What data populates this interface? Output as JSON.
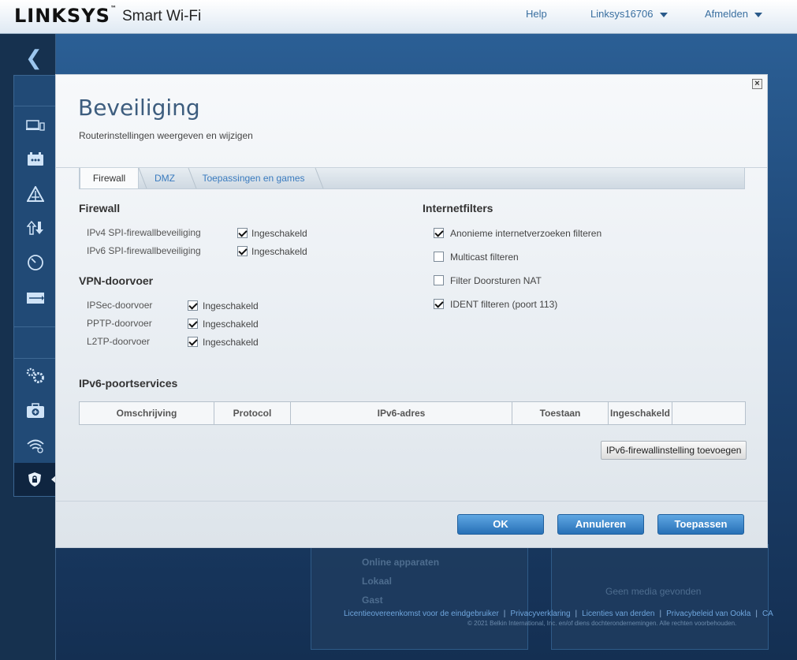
{
  "header": {
    "logo": "LINKSYS",
    "logo_tm": "™",
    "product": "Smart Wi-Fi",
    "help": "Help",
    "account": "Linksys16706",
    "logout": "Afmelden"
  },
  "background": {
    "card1_line1": "Online apparaten",
    "card1_line2": "Lokaal",
    "card1_line3": "Gast",
    "card2_text": "Geen media gevonden"
  },
  "footer": {
    "links": [
      "Licentieovereenkomst voor de eindgebruiker",
      "Privacyverklaring",
      "Licenties van derden",
      "Privacybeleid van Ookla",
      "CA"
    ],
    "copyright": "© 2021 Belkin International, Inc. en/of diens dochterondernemingen. Alle rechten voorbehouden."
  },
  "modal": {
    "close": "×",
    "title": "Beveiliging",
    "subtitle": "Routerinstellingen weergeven en wijzigen",
    "tabs": [
      "Firewall",
      "DMZ",
      "Toepassingen en games"
    ],
    "firewall": {
      "heading": "Firewall",
      "rows": [
        {
          "label": "IPv4 SPI-firewallbeveiliging",
          "value": "Ingeschakeld",
          "checked": true
        },
        {
          "label": "IPv6 SPI-firewallbeveiliging",
          "value": "Ingeschakeld",
          "checked": true
        }
      ]
    },
    "vpn": {
      "heading": "VPN-doorvoer",
      "rows": [
        {
          "label": "IPSec-doorvoer",
          "value": "Ingeschakeld",
          "checked": true
        },
        {
          "label": "PPTP-doorvoer",
          "value": "Ingeschakeld",
          "checked": true
        },
        {
          "label": "L2TP-doorvoer",
          "value": "Ingeschakeld",
          "checked": true
        }
      ]
    },
    "internet_filters": {
      "heading": "Internetfilters",
      "rows": [
        {
          "label": "Anonieme internetverzoeken filteren",
          "checked": true
        },
        {
          "label": "Multicast filteren",
          "checked": false
        },
        {
          "label": "Filter Doorsturen NAT",
          "checked": false
        },
        {
          "label": "IDENT filteren (poort 113)",
          "checked": true
        }
      ]
    },
    "ipv6": {
      "heading": "IPv6-poortservices",
      "columns": [
        "Omschrijving",
        "Protocol",
        "IPv6-adres",
        "Toestaan",
        "Ingeschakeld",
        ""
      ],
      "add_button": "IPv6-firewallinstelling toevoegen"
    },
    "buttons": {
      "ok": "OK",
      "cancel": "Annuleren",
      "apply": "Toepassen"
    }
  }
}
